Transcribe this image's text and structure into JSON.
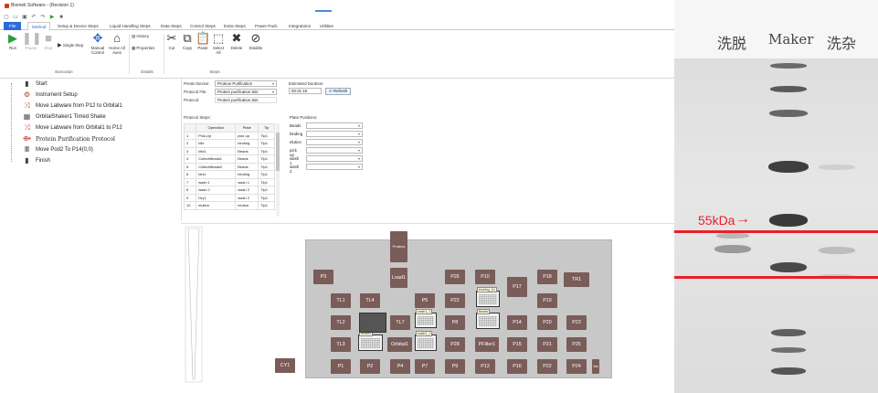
{
  "window": {
    "title": "Biomek Software - (Revision 1)"
  },
  "quick_access_icons": [
    "new-icon",
    "open-icon",
    "save-icon",
    "undo-icon",
    "redo-icon",
    "run-icon",
    "stop-icon"
  ],
  "ribbon": {
    "tabs": [
      {
        "label": "File"
      },
      {
        "label": "Method"
      },
      {
        "label": "Setup & Device Steps"
      },
      {
        "label": "Liquid Handling Steps"
      },
      {
        "label": "Data Steps"
      },
      {
        "label": "Control Steps"
      },
      {
        "label": "Extra Steps"
      },
      {
        "label": "Power Pack"
      },
      {
        "label": "Integrations"
      },
      {
        "label": "Utilities"
      }
    ],
    "execution": {
      "group_label": "Execution",
      "run": "Run",
      "pause": "Pause",
      "stop": "Stop",
      "single_step": "Single Step",
      "manual_control": "Manual Control",
      "home_all_axes": "Home All Axes"
    },
    "details": {
      "group_label": "Details",
      "history": "History",
      "properties": "Properties"
    },
    "steps": {
      "group_label": "Steps",
      "cut": "Cut",
      "copy": "Copy",
      "paste": "Paste",
      "select_all": "Select All",
      "delete": "Delete",
      "disable": "Disable"
    }
  },
  "method_steps": [
    {
      "label": "Start",
      "icon": "start-icon"
    },
    {
      "label": "Instrument Setup",
      "icon": "instrument-setup-icon"
    },
    {
      "label": "Move Labware from P12 to Orbital1",
      "icon": "move-labware-icon"
    },
    {
      "label": "OrbitalShaker1 Timed Shake",
      "icon": "shaker-icon"
    },
    {
      "label": "Move Labware from Orbital1 to P12",
      "icon": "move-labware-icon"
    },
    {
      "label": "Protein Purification Protocol",
      "icon": "protocol-icon"
    },
    {
      "label": "Move Pod2 To P14(0,0)",
      "icon": "move-pod-icon"
    },
    {
      "label": "Finish",
      "icon": "finish-icon"
    }
  ],
  "properties": {
    "preset_device_label": "Presto Device:",
    "preset_device_value": "Proteus Purification",
    "protocol_file_label": "Protocol File:",
    "protocol_file_value": "Protein purification.bdz",
    "protocol_label": "Protocol:",
    "protocol_value": "Protein purification.bdz",
    "estimated_duration_label": "Estimated Duration:",
    "estimated_duration_value": "00:31:19",
    "refresh_label": "Refresh",
    "protocol_steps_label": "Protocol Steps:",
    "plate_positions_label": "Plate Positions:",
    "table_headers": [
      "",
      "Operation",
      "Plate",
      "Tip"
    ],
    "table_rows": [
      [
        "1",
        "Pick-Up",
        "pick up",
        "Tip1"
      ],
      [
        "2",
        "Mix",
        "binding",
        "Tip1"
      ],
      [
        "3",
        "Mix1",
        "Beads",
        "Tip1"
      ],
      [
        "4",
        "CollectBeads1",
        "Beads",
        "Tip1"
      ],
      [
        "5",
        "CollectBeads2",
        "Beads",
        "Tip1"
      ],
      [
        "6",
        "bind",
        "binding",
        "Tip1"
      ],
      [
        "7",
        "wash 1",
        "wash 1",
        "Tip1"
      ],
      [
        "8",
        "wash 2",
        "wash 2",
        "Tip1"
      ],
      [
        "9",
        "Dry1",
        "wash 2",
        "Tip1"
      ],
      [
        "10",
        "elution",
        "elution",
        "Tip1"
      ]
    ],
    "plate_positions": [
      {
        "name": "Beads",
        "value": ""
      },
      {
        "name": "binding",
        "value": ""
      },
      {
        "name": "elution",
        "value": ""
      },
      {
        "name": "pick up",
        "value": ""
      },
      {
        "name": "wash 1",
        "value": ""
      },
      {
        "name": "wash 2",
        "value": ""
      }
    ]
  },
  "deck": {
    "positions": [
      "Proteus",
      "Load1",
      "P3",
      "P26",
      "P10",
      "P17",
      "P18",
      "TR1",
      "TL1",
      "TL4",
      "P5",
      "P22",
      "P19",
      "TL2",
      "TL7",
      "P8",
      "P14",
      "P20",
      "P23",
      "TL3",
      "Orbital1",
      "P28",
      "PFilter1",
      "P15",
      "P21",
      "P25",
      "CY1",
      "P1",
      "P2",
      "P4",
      "P7",
      "P9",
      "P13",
      "P16",
      "P22",
      "P24",
      "Wa"
    ],
    "plate_labels": [
      "binding_(1)",
      "wash1_1",
      "Beads",
      "elution",
      "wash2_1"
    ]
  },
  "gel": {
    "lane_labels": [
      "洗脱",
      "Maker",
      "洗杂"
    ],
    "marker_label": "55kDa",
    "arrow": "→"
  }
}
